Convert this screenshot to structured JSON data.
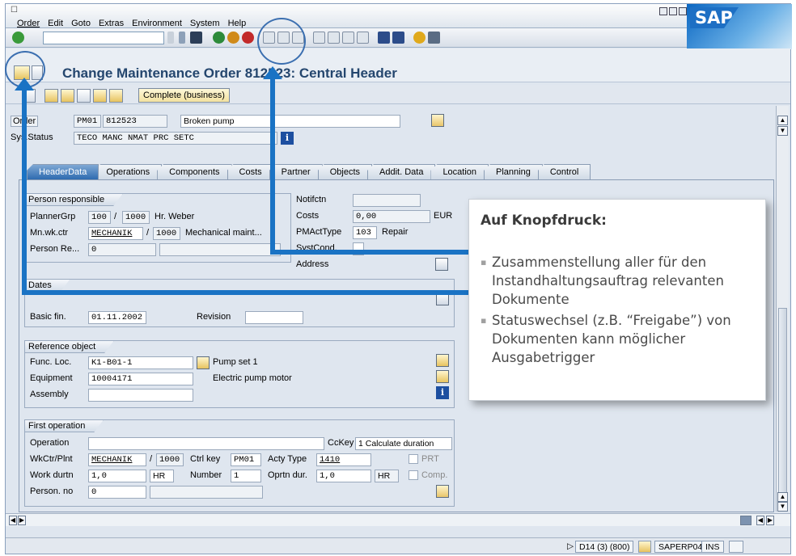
{
  "menu": [
    "Order",
    "Edit",
    "Goto",
    "Extras",
    "Environment",
    "System",
    "Help"
  ],
  "window": {
    "logo": "SAP"
  },
  "title": "Change Maintenance Order 812523: Central Header",
  "app_toolbar": {
    "complete_label": "Complete (business)"
  },
  "header": {
    "order_label": "Order",
    "order_type": "PM01",
    "order_number": "812523",
    "description": "Broken pump",
    "sysstatus_label": "Sys.Status",
    "sysstatus_value": "TECO MANC NMAT PRC  SETC"
  },
  "tabs": [
    "HeaderData",
    "Operations",
    "Components",
    "Costs",
    "Partner",
    "Objects",
    "Addit. Data",
    "Location",
    "Planning",
    "Control"
  ],
  "person_responsible": {
    "group_title": "Person responsible",
    "planner_label": "PlannerGrp",
    "planner_value": "100",
    "planner_slash": "/",
    "planner_plant": "1000",
    "planner_name": "Hr. Weber",
    "wkctr_label": "Mn.wk.ctr",
    "wkctr_value": "MECHANIK",
    "wkctr_slash": "/",
    "wkctr_plant": "1000",
    "wkctr_desc": "Mechanical maint...",
    "person_label": "Person Re...",
    "person_value": "0"
  },
  "notif": {
    "notifctn_label": "Notifctn",
    "costs_label": "Costs",
    "costs_value": "0,00",
    "currency": "EUR",
    "pmact_label": "PMActType",
    "pmact_value": "103",
    "pmact_desc": "Repair",
    "systcond_label": "SystCond.",
    "address_label": "Address"
  },
  "dates": {
    "group_title": "Dates",
    "basic_label": "Basic fin.",
    "basic_value": "01.11.2002",
    "revision_label": "Revision"
  },
  "reference": {
    "group_title": "Reference object",
    "funcloc_label": "Func. Loc.",
    "funcloc_value": "K1-B01-1",
    "funcloc_desc": "Pump set 1",
    "equipment_label": "Equipment",
    "equipment_value": "10004171",
    "equipment_desc": "Electric pump motor",
    "assembly_label": "Assembly"
  },
  "first_operation": {
    "group_title": "First operation",
    "operation_label": "Operation",
    "cckey_label": "CcKey",
    "cckey_value": "1 Calculate duration",
    "wkctr_label": "WkCtr/Plnt",
    "wkctr_value": "MECHANIK",
    "wkctr_slash": "/",
    "wkctr_plant": "1000",
    "ctrlkey_label": "Ctrl key",
    "ctrlkey_value": "PM01",
    "actytype_label": "Acty Type",
    "actytype_value": "1410",
    "prt_label": "PRT",
    "workdurtn_label": "Work durtn",
    "workdurtn_value": "1,0",
    "workdurtn_unit": "HR",
    "number_label": "Number",
    "number_value": "1",
    "oprtndur_label": "Oprtn dur.",
    "oprtndur_value": "1,0",
    "oprtndur_unit": "HR",
    "comp_label": "Comp.",
    "personno_label": "Person. no",
    "personno_value": "0"
  },
  "status_bar": {
    "system": "D14 (3) (800)",
    "server": "SAPERP04",
    "mode": "INS"
  },
  "callout": {
    "heading": "Auf Knopfdruck:",
    "items": [
      "Zusammenstellung aller für den Instandhaltungsauftrag relevanten Dokumente",
      "Statuswechsel (z.B. “Freigabe”) von Dokumenten kann möglicher Ausgabetrigger"
    ]
  }
}
